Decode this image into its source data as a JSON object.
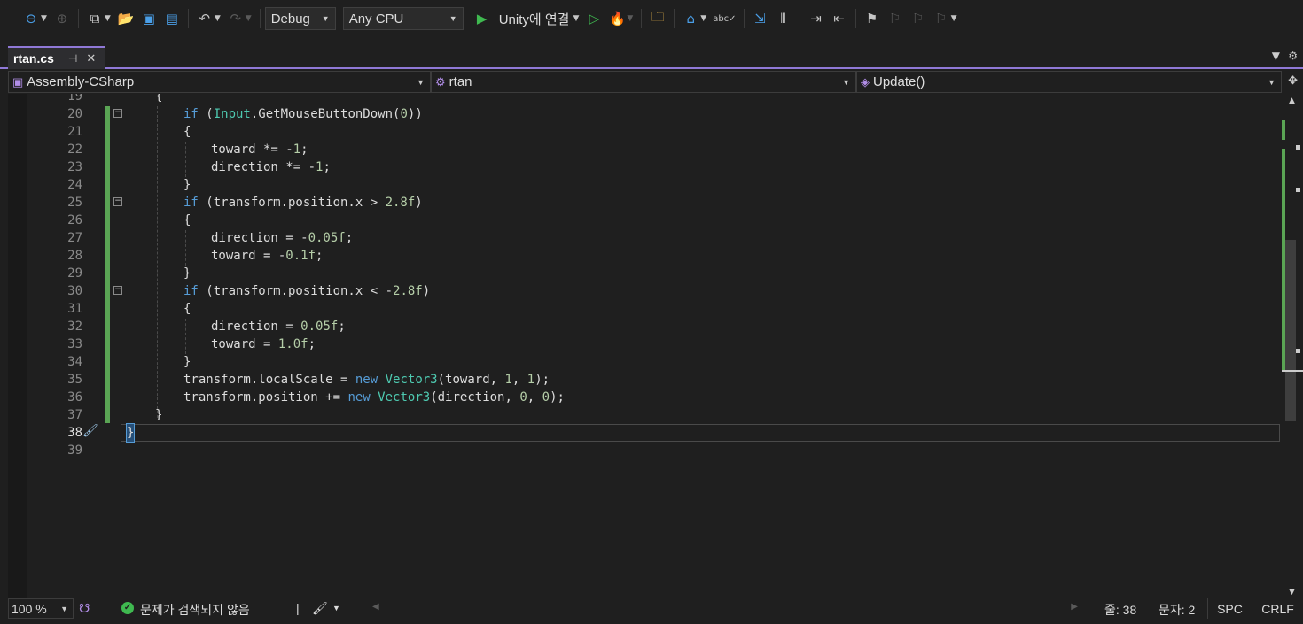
{
  "toolbar": {
    "config": "Debug",
    "platform": "Any CPU",
    "run_label": "Unity에 연결",
    "icons": [
      "back-icon",
      "forward-icon",
      "new-project-icon",
      "open-folder-icon",
      "save-icon",
      "save-all-icon",
      "undo-icon",
      "redo-icon",
      "play-icon",
      "play-no-debug-icon",
      "hot-reload-icon",
      "solution-explorer-icon",
      "browse-icon",
      "spell-check-icon",
      "find-icon",
      "layout-icon",
      "indent-icon",
      "outdent-icon",
      "bookmark-icon",
      "bookmark-prev-icon",
      "bookmark-next-icon",
      "bookmark-clear-icon"
    ]
  },
  "tab": {
    "title": "rtan.cs",
    "pin": "⊣",
    "close": "✕"
  },
  "navbar": {
    "project": "Assembly-CSharp",
    "class": "rtan",
    "member": "Update()"
  },
  "editor": {
    "lines": [
      {
        "num": "19",
        "code": "{"
      },
      {
        "num": "20",
        "code": "if (Input.GetMouseButtonDown(0))"
      },
      {
        "num": "21",
        "code": "{"
      },
      {
        "num": "22",
        "code": "toward *= -1;"
      },
      {
        "num": "23",
        "code": "direction *= -1;"
      },
      {
        "num": "24",
        "code": "}"
      },
      {
        "num": "25",
        "code": "if (transform.position.x > 2.8f)"
      },
      {
        "num": "26",
        "code": "{"
      },
      {
        "num": "27",
        "code": "direction = -0.05f;"
      },
      {
        "num": "28",
        "code": "toward = -0.1f;"
      },
      {
        "num": "29",
        "code": "}"
      },
      {
        "num": "30",
        "code": "if (transform.position.x < -2.8f)"
      },
      {
        "num": "31",
        "code": "{"
      },
      {
        "num": "32",
        "code": "direction = 0.05f;"
      },
      {
        "num": "33",
        "code": "toward = 1.0f;"
      },
      {
        "num": "34",
        "code": "}"
      },
      {
        "num": "35",
        "code": "transform.localScale = new Vector3(toward, 1, 1);"
      },
      {
        "num": "36",
        "code": "transform.position += new Vector3(direction, 0, 0);"
      },
      {
        "num": "37",
        "code": "}"
      },
      {
        "num": "38",
        "code": "}"
      },
      {
        "num": "39",
        "code": ""
      }
    ]
  },
  "status": {
    "zoom": "100 %",
    "issues": "문제가 검색되지 않음",
    "line": "줄: 38",
    "col": "문자: 2",
    "spc": "SPC",
    "eol": "CRLF"
  },
  "colors": {
    "accent": "#8f78d6",
    "keyword": "#569cd6",
    "type": "#4ec9b0",
    "number": "#b5cea8",
    "change_bar": "#5aa454"
  }
}
